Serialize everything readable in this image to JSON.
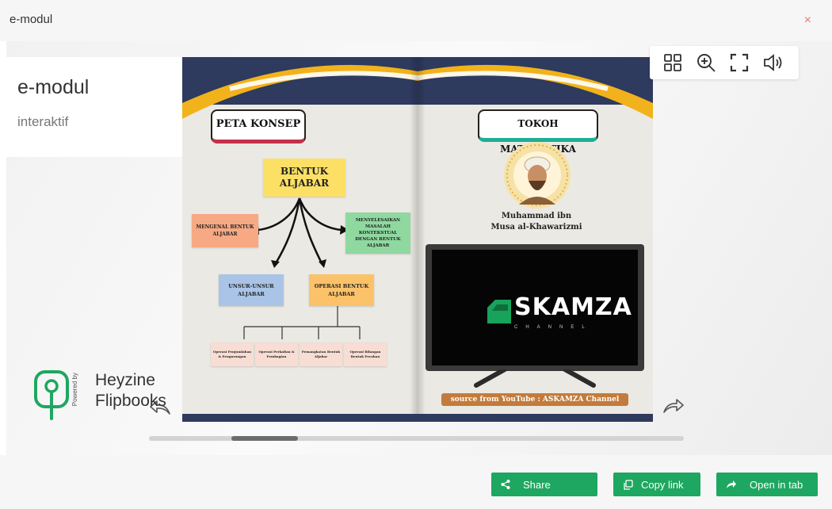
{
  "window": {
    "title": "e-modul",
    "close_glyph": "×"
  },
  "info": {
    "title": "e-modul",
    "subtitle": "interaktif"
  },
  "toolbar": {
    "icons": [
      "grid-icon",
      "zoom-in-icon",
      "fullscreen-icon",
      "speaker-icon"
    ]
  },
  "left_page": {
    "heading": "PETA KONSEP",
    "main": "BENTUK ALJABAR",
    "left": "MENGENAL BENTUK ALJABAR",
    "right": "MENYELESAIKAN MASALAH KONTEKSTUAL DENGAN BENTUK ALJABAR",
    "unsur": "UNSUR-UNSUR ALJABAR",
    "operasi": "OPERASI BENTUK ALJABAR",
    "leaves": [
      "Operasi Penjumlahan & Pengurangan",
      "Operasi Perkalian & Pembagian",
      "Pemangkatan Bentuk Aljabar",
      "Operasi Bilangan Bentuk Pecahan"
    ]
  },
  "right_page": {
    "heading": "TOKOH MATEMATIKA",
    "name_line1": "Muhammad ibn",
    "name_line2": "Musa al-Khawarizmi",
    "video_brand": "SKAMZA",
    "video_brand_sub": "CHANNEL",
    "source": "source from YouTube : ASKAMZA Channel"
  },
  "branding": {
    "line1": "Heyzine",
    "line2": "Flipbooks",
    "powered": "Powered by"
  },
  "footer": {
    "share": "Share",
    "copy": "Copy link",
    "open": "Open in tab"
  },
  "colors": {
    "accent": "#1ea760",
    "navy": "#2e3a5e",
    "gold": "#f2b21b"
  }
}
